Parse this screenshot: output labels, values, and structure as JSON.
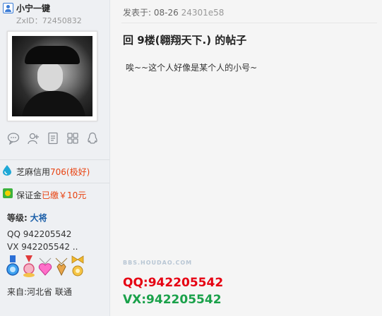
{
  "user": {
    "name": "小宁一键",
    "id_text": "ZxID：72450832"
  },
  "actions": [
    {
      "icon": "message-icon"
    },
    {
      "icon": "add-friend-icon"
    },
    {
      "icon": "document-icon"
    },
    {
      "icon": "grid-icon"
    },
    {
      "icon": "qq-penguin-icon"
    }
  ],
  "credit": {
    "label": "芝麻信用",
    "score": "706",
    "grade": "(极好)"
  },
  "deposit": {
    "label": "保证金",
    "status": "已缴",
    "amount": "￥10元"
  },
  "level": {
    "label": "等级:",
    "value": "大将"
  },
  "contact_small": {
    "qq": "QQ 942205542",
    "vx": "VX 942205542  .."
  },
  "medals": [
    "blue-shield-medal-icon",
    "red-ribbon-medal-icon",
    "pink-heart-medal-icon",
    "fox-pendant-medal-icon",
    "gold-bow-medal-icon"
  ],
  "from": "来自:河北省 联通",
  "post": {
    "time_label": "发表于:",
    "date": "08-26",
    "hash": "24301e58",
    "title": "回 9楼(翱翔天下.) 的帖子",
    "body": "唉~~这个人好像是某个人的小号~",
    "watermark": "BBS.HOUDAO.COM",
    "qq": "QQ:942205542",
    "vx": "VX:942205542"
  },
  "colors": {
    "qq_red": "#e60012",
    "vx_green": "#1aa14a",
    "orange": "#e8410f",
    "level_blue": "#1a5ea8"
  }
}
